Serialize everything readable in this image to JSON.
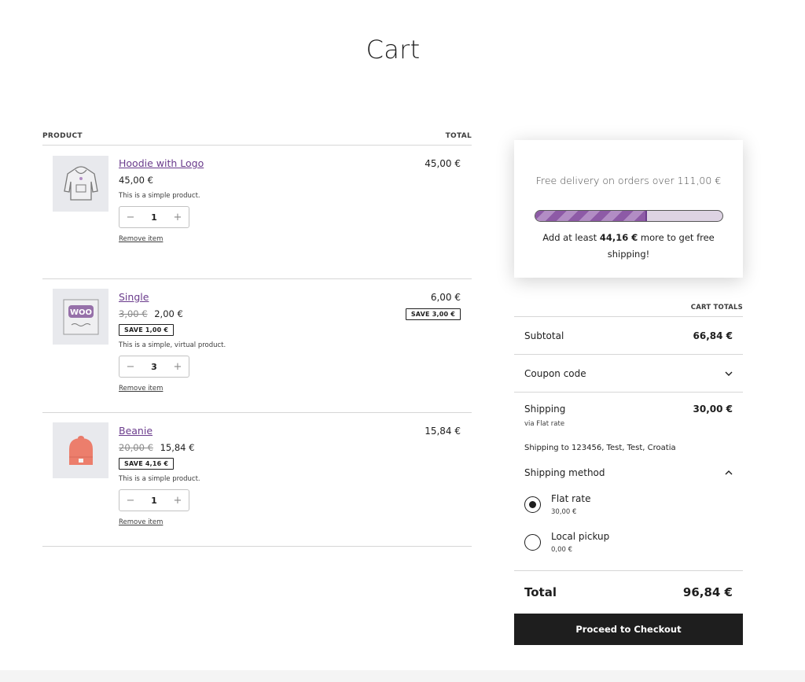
{
  "page": {
    "title": "Cart"
  },
  "cart": {
    "headers": {
      "product": "PRODUCT",
      "total": "TOTAL"
    },
    "items": [
      {
        "name": "Hoodie with Logo",
        "price": "45,00 €",
        "old_price": "",
        "save_badge": "",
        "description": "This is a simple product.",
        "quantity": "1",
        "line_total": "45,00 €",
        "line_save": "",
        "remove_label": "Remove item",
        "image_icon": "hoodie-image"
      },
      {
        "name": "Single",
        "price": "2,00 €",
        "old_price": "3,00 €",
        "save_badge": "SAVE 1,00 €",
        "description": "This is a simple, virtual product.",
        "quantity": "3",
        "line_total": "6,00 €",
        "line_save": "SAVE 3,00 €",
        "remove_label": "Remove item",
        "image_icon": "woo-album-image",
        "image_text": "WOO"
      },
      {
        "name": "Beanie",
        "price": "15,84 €",
        "old_price": "20,00 €",
        "save_badge": "SAVE 4,16 €",
        "description": "This is a simple product.",
        "quantity": "1",
        "line_total": "15,84 €",
        "line_save": "",
        "remove_label": "Remove item",
        "image_icon": "beanie-image"
      }
    ]
  },
  "promo": {
    "title": "Free delivery on orders over 111,00 €",
    "msg_prefix": "Add at least ",
    "msg_amount": "44,16 €",
    "msg_suffix": " more to get free shipping!",
    "progress_percent": 60,
    "bar_colors": [
      "#8d5aa6",
      "#b28dc4",
      "#ddd3e3"
    ]
  },
  "totals": {
    "header": "CART TOTALS",
    "subtotal_label": "Subtotal",
    "subtotal_value": "66,84 €",
    "coupon_label": "Coupon code",
    "shipping_label": "Shipping",
    "shipping_value": "30,00 €",
    "shipping_via": "via Flat rate",
    "shipping_to": "Shipping to 123456, Test, Test, Croatia",
    "method_label": "Shipping method",
    "options": [
      {
        "label": "Flat rate",
        "price": "30,00 €",
        "selected": true
      },
      {
        "label": "Local pickup",
        "price": "0,00 €",
        "selected": false
      }
    ],
    "total_label": "Total",
    "total_value": "96,84 €",
    "checkout_label": "Proceed to Checkout"
  },
  "colors": {
    "link": "#6a3b8c",
    "button_bg": "#1e1e1e",
    "button_text": "#ffffff"
  }
}
